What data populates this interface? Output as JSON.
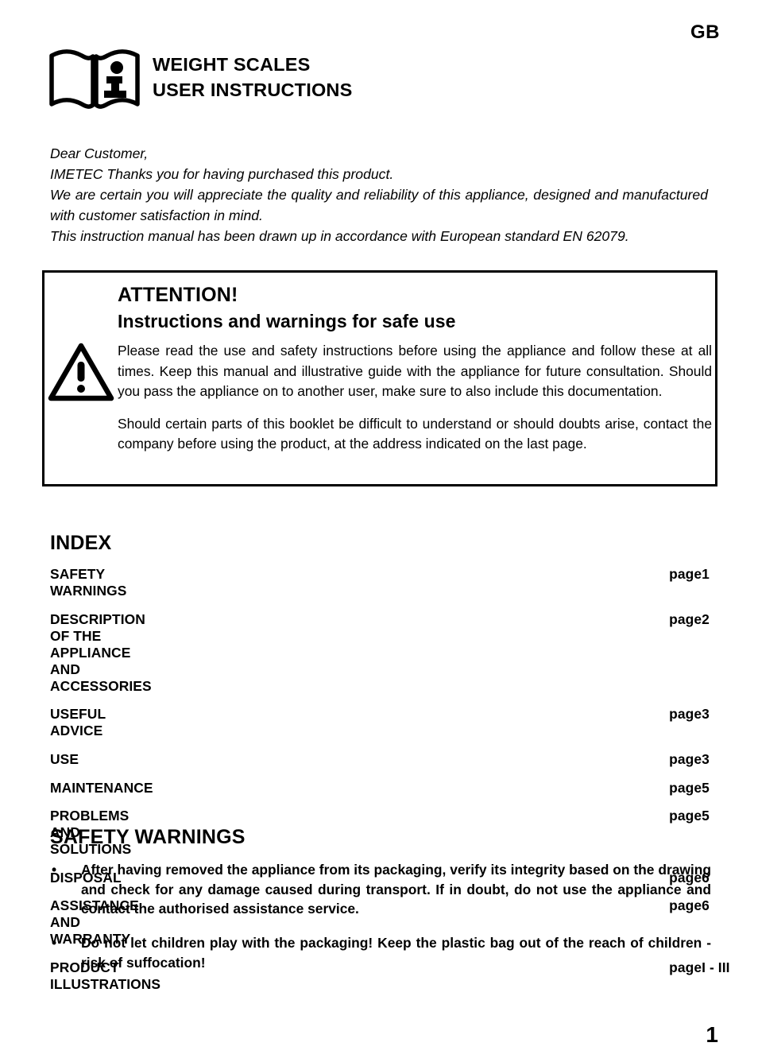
{
  "header": {
    "language_code": "GB",
    "icon": "manual-book-info-icon",
    "title_lines": [
      "WEIGHT SCALES",
      "USER INSTRUCTIONS"
    ]
  },
  "intro": {
    "salutation": "Dear Customer,",
    "line_2": "IMETEC Thanks you for having purchased this product.",
    "line_3": "We are certain you will appreciate the quality and reliability of this appliance, designed and manufactured with customer satisfaction in mind.",
    "line_4": "This instruction manual has been drawn up in accordance with European standard EN 62079."
  },
  "attention": {
    "icon": "warning-triangle-icon",
    "heading": "ATTENTION!",
    "subheading": "Instructions and warnings for safe use",
    "paragraph_1": "Please read the use and safety instructions before using the appliance and follow these at all times. Keep this manual and illustrative guide with the appliance for future consultation. Should you pass the appliance on to another user, make sure to also include this documentation.",
    "paragraph_2": "Should certain parts of this booklet be difficult to understand or should doubts arise, contact the company before using the product, at the address indicated on the last page."
  },
  "index": {
    "heading": "INDEX",
    "page_label": "page",
    "entries": [
      {
        "title": "SAFETY WARNINGS",
        "label": "page",
        "page": "1"
      },
      {
        "title": "DESCRIPTION OF THE APPLIANCE AND ACCESSORIES",
        "label": "page",
        "page": "2"
      },
      {
        "title": "USEFUL ADVICE",
        "label": "page",
        "page": "3"
      },
      {
        "title": "USE",
        "label": "page",
        "page": "3"
      },
      {
        "title": "MAINTENANCE",
        "label": "page",
        "page": "5"
      },
      {
        "title": "PROBLEMS AND SOLUTIONS",
        "label": "page",
        "page": "5"
      },
      {
        "title": "DISPOSAL",
        "label": "page",
        "page": "6"
      },
      {
        "title": "ASSISTANCE AND WARRANTY",
        "label": "page",
        "page": "6"
      },
      {
        "title": "PRODUCT ILLUSTRATIONS",
        "label": "page",
        "page": "I - III"
      }
    ]
  },
  "safety_warnings": {
    "heading": "SAFETY WARNINGS",
    "bullet_glyph": "•",
    "items": [
      "After having removed the appliance from its packaging, verify its integrity based on the drawing and check for any damage caused during transport. If in doubt, do not use the appliance and contact the authorised assistance service.",
      "Do not let children play with the packaging! Keep the plastic bag out of the reach of children - risk of suffocation!"
    ]
  },
  "footer": {
    "page_number": "1"
  }
}
